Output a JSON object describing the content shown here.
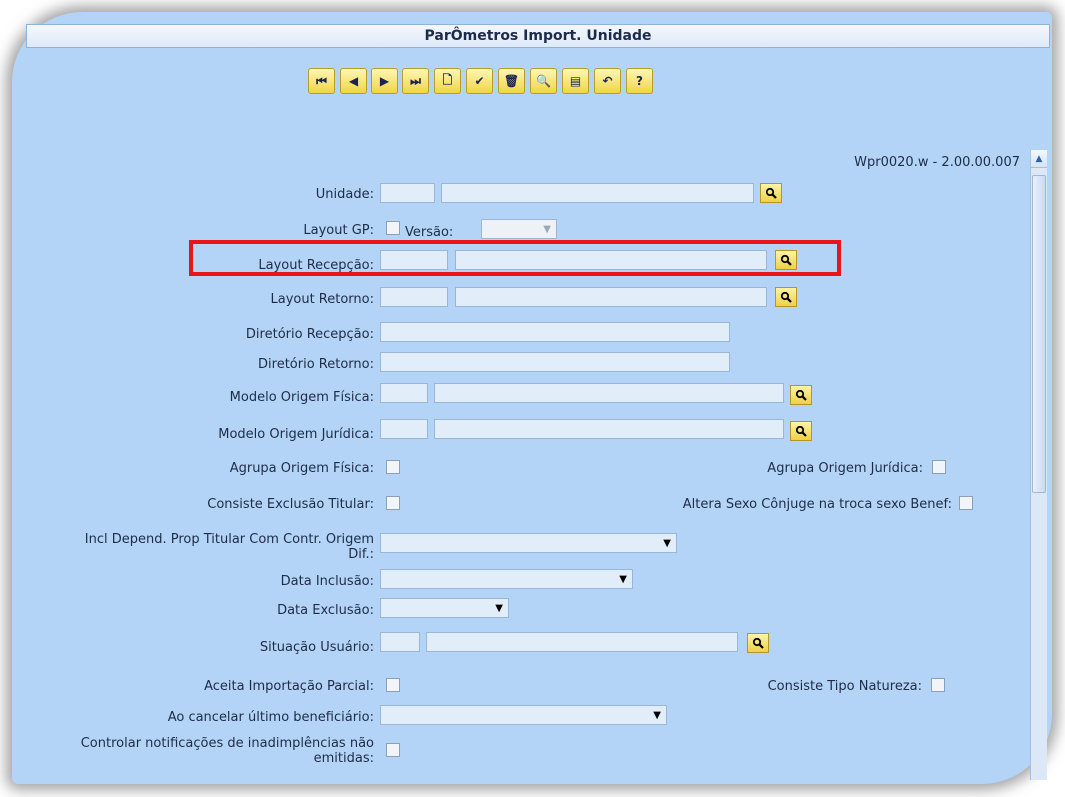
{
  "window": {
    "title": "ParÔmetros Import. Unidade",
    "version_text": "Wpr0020.w - 2.00.00.007"
  },
  "toolbar": [
    {
      "name": "first-record",
      "glyph": "⏮"
    },
    {
      "name": "previous-record",
      "glyph": "◀"
    },
    {
      "name": "next-record",
      "glyph": "▶"
    },
    {
      "name": "last-record",
      "glyph": "⏭"
    },
    {
      "name": "new-record",
      "glyph": "🗋"
    },
    {
      "name": "save",
      "glyph": "✔"
    },
    {
      "name": "delete",
      "glyph": "🗑"
    },
    {
      "name": "search",
      "glyph": "🔍"
    },
    {
      "name": "list",
      "glyph": "▤"
    },
    {
      "name": "undo",
      "glyph": "↶"
    },
    {
      "name": "help",
      "glyph": "?"
    }
  ],
  "form": {
    "unidade": {
      "label": "Unidade:"
    },
    "layout_gp": {
      "label": "Layout GP:"
    },
    "versao": {
      "label": "Versão:"
    },
    "layout_recepcao": {
      "label": "Layout Recepção:"
    },
    "layout_retorno": {
      "label": "Layout Retorno:"
    },
    "diretorio_recepcao": {
      "label": "Diretório Recepção:"
    },
    "diretorio_retorno": {
      "label": "Diretório Retorno:"
    },
    "modelo_origem_fisica": {
      "label": "Modelo Origem Física:"
    },
    "modelo_origem_juridica": {
      "label": "Modelo Origem Jurídica:"
    },
    "agrupa_origem_fisica": {
      "label": "Agrupa Origem Física:"
    },
    "agrupa_origem_juridica": {
      "label": "Agrupa Origem Jurídica:"
    },
    "consiste_exclusao_titular": {
      "label": "Consiste Exclusão Titular:"
    },
    "altera_sexo_conjuge": {
      "label": "Altera Sexo Cônjuge na troca sexo Benef:"
    },
    "incl_depend": {
      "label": "Incl Depend. Prop Titular Com Contr. Origem Dif.:"
    },
    "data_inclusao": {
      "label": "Data Inclusão:"
    },
    "data_exclusao": {
      "label": "Data Exclusão:"
    },
    "situacao_usuario": {
      "label": "Situação Usuário:"
    },
    "aceita_importacao_parcial": {
      "label": "Aceita Importação Parcial:"
    },
    "consiste_tipo_natureza": {
      "label": "Consiste Tipo Natureza:"
    },
    "ao_cancelar": {
      "label": "Ao cancelar último beneficiário:"
    },
    "controlar_notificacoes": {
      "label": "Controlar notificações de inadimplências não emitidas:"
    }
  },
  "colors": {
    "background": "#b3d4f7",
    "highlight": "#e8141b",
    "button": "#f0d545"
  }
}
